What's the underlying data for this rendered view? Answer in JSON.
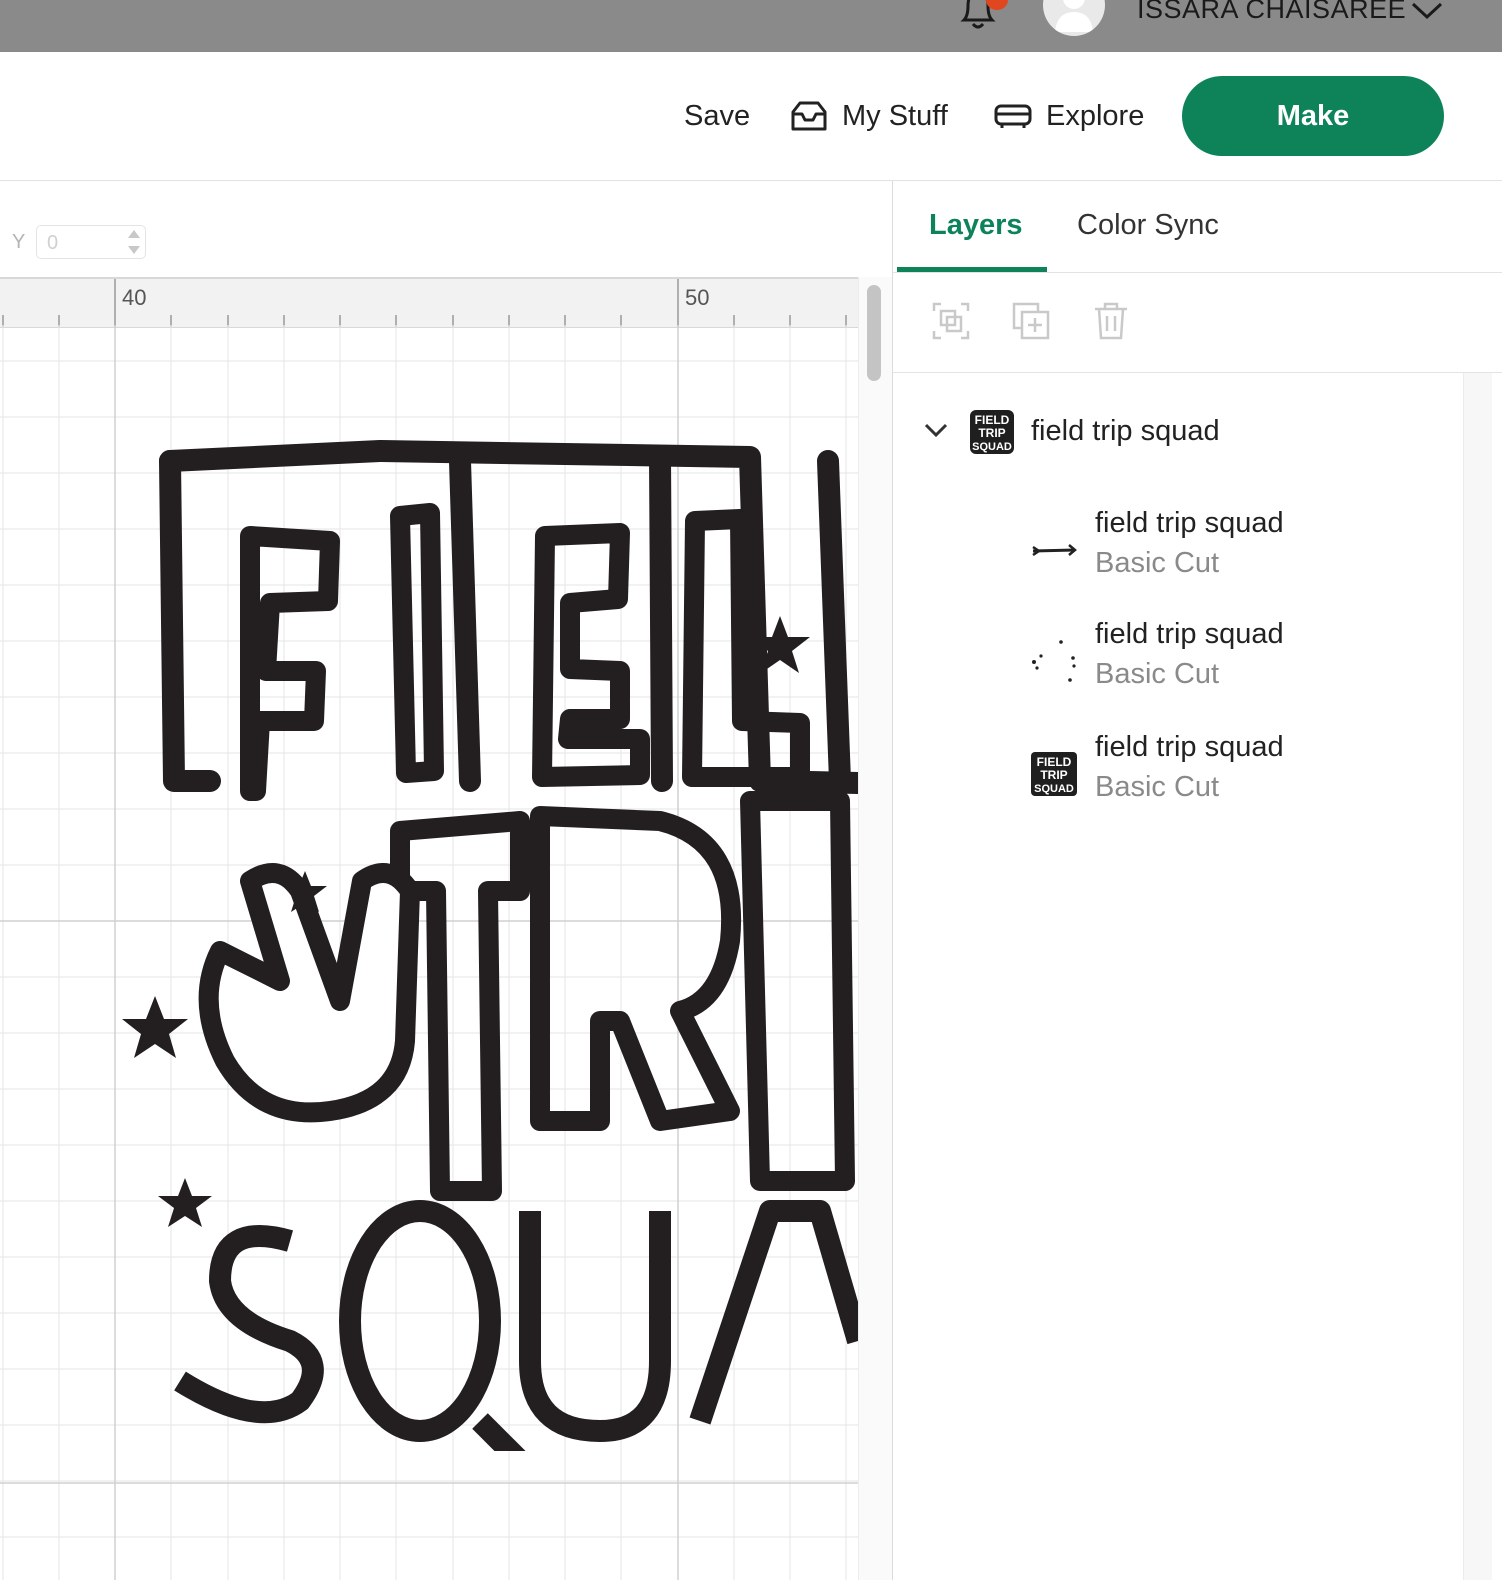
{
  "topbar": {
    "user_name": "ISSARA CHAISAREE",
    "icons": [
      "bell-icon",
      "avatar",
      "chevron-down-icon"
    ],
    "notification_color": "#e0471f"
  },
  "header": {
    "save_label": "Save",
    "mystuff_label": "My Stuff",
    "explore_label": "Explore",
    "make_label": "Make",
    "accent": "#0e8359"
  },
  "canvas": {
    "y_label": "Y",
    "y_value": "0",
    "ruler_labels": [
      "40",
      "50"
    ],
    "design_text": "FIELD TRIP SQUAD"
  },
  "panel": {
    "tabs": [
      {
        "label": "Layers",
        "active": true
      },
      {
        "label": "Color Sync",
        "active": false
      }
    ],
    "tools": [
      "group-icon",
      "duplicate-icon",
      "delete-icon"
    ],
    "group": {
      "name": "field trip squad",
      "expanded": true
    },
    "layers": [
      {
        "name": "field trip squad",
        "operation": "Basic Cut",
        "thumb": "arrow"
      },
      {
        "name": "field trip squad",
        "operation": "Basic Cut",
        "thumb": "stars"
      },
      {
        "name": "field trip squad",
        "operation": "Basic Cut",
        "thumb": "text"
      }
    ]
  }
}
